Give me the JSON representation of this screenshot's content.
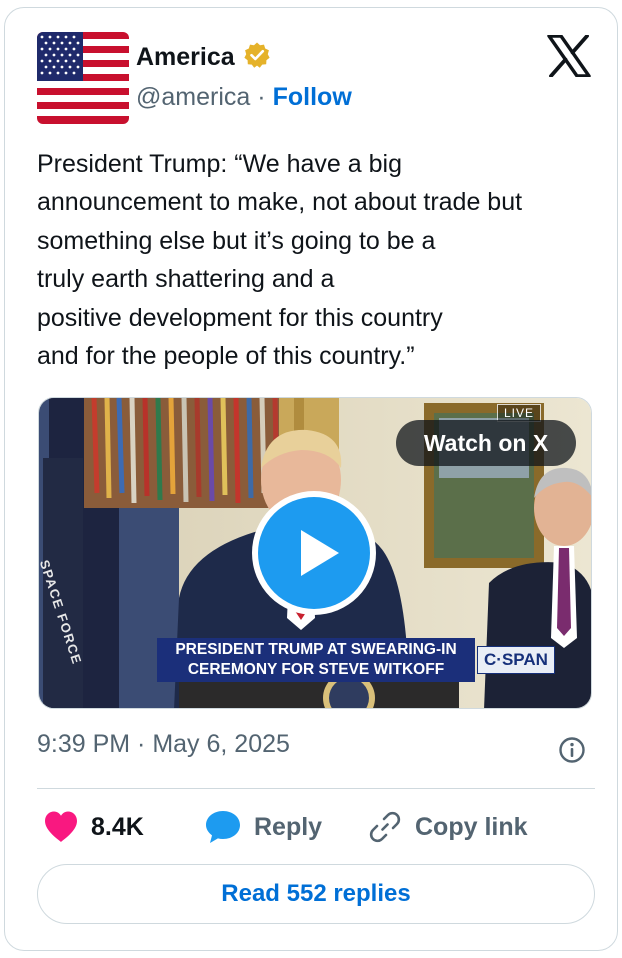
{
  "header": {
    "display_name": "America",
    "handle": "@america",
    "separator": "·",
    "follow_label": "Follow",
    "verified_color": "#e5b22a"
  },
  "tweet": {
    "lines": [
      "President Trump: “We have a big",
      "announcement to make, not about trade but",
      "something else but it’s going to be a",
      "truly earth shattering and a",
      "positive development for this country",
      "and for the people of this country.”"
    ]
  },
  "media": {
    "live_label": "LIVE",
    "watch_label": "Watch on X",
    "chyron_line1": "PRESIDENT TRUMP AT SWEARING-IN",
    "chyron_line2": "CEREMONY FOR STEVE WITKOFF",
    "network_label": "C·SPAN",
    "flag_text": "SPACE FORCE",
    "play_color": "#1d9bf0"
  },
  "meta": {
    "timestamp": "9:39 PM · May 6, 2025"
  },
  "actions": {
    "like_count": "8.4K",
    "reply_label": "Reply",
    "copy_label": "Copy link",
    "like_color": "#f91880",
    "reply_icon_color": "#1d9bf0"
  },
  "footer": {
    "read_replies_label": "Read 552 replies"
  },
  "icons": {
    "avatar": "us-flag-avatar",
    "verified": "verified-badge-icon",
    "logo": "x-logo-icon",
    "info": "info-icon",
    "like": "heart-icon",
    "reply": "speech-bubble-icon",
    "copy": "link-icon",
    "play": "play-icon"
  }
}
